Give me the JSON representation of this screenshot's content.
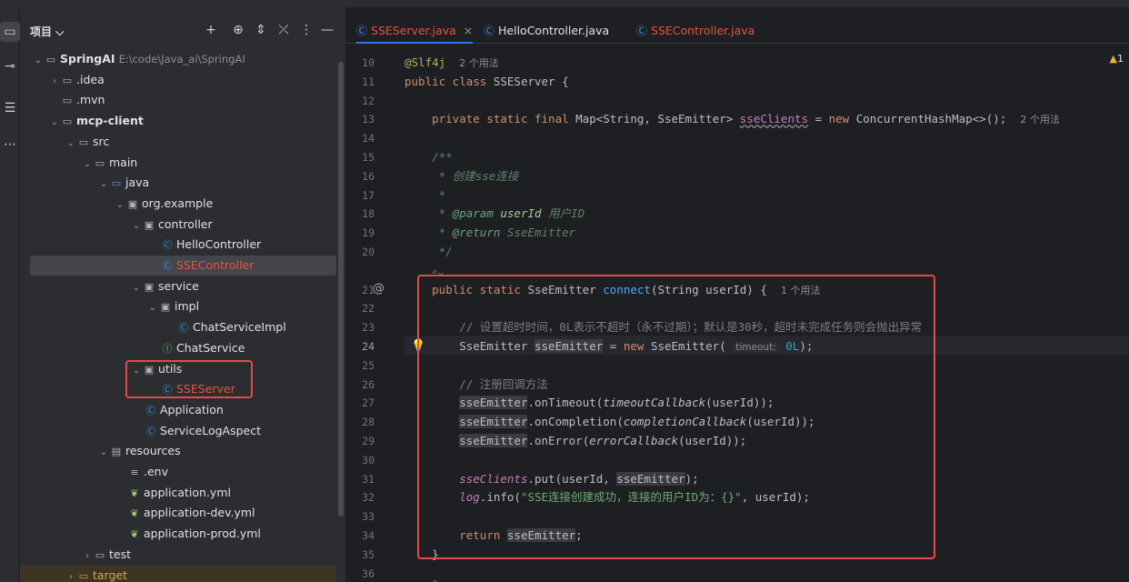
{
  "project": {
    "title": "项目",
    "tree": [
      {
        "name": "SpringAI",
        "extra": "E:\\code\\Java_ai\\SpringAI",
        "icon": "module-folder-icon"
      },
      {
        "name": ".idea",
        "icon": "folder-icon"
      },
      {
        "name": ".mvn",
        "icon": "folder-icon"
      },
      {
        "name": "mcp-client",
        "icon": "module-folder-icon"
      },
      {
        "name": "src",
        "icon": "folder-icon"
      },
      {
        "name": "main",
        "icon": "folder-icon"
      },
      {
        "name": "java",
        "icon": "source-folder-icon"
      },
      {
        "name": "org.example",
        "icon": "package-icon"
      },
      {
        "name": "controller",
        "icon": "package-icon"
      },
      {
        "name": "HelloController",
        "icon": "class-icon"
      },
      {
        "name": "SSEController",
        "icon": "class-icon"
      },
      {
        "name": "service",
        "icon": "package-icon"
      },
      {
        "name": "impl",
        "icon": "package-icon"
      },
      {
        "name": "ChatServiceImpl",
        "icon": "class-icon"
      },
      {
        "name": "ChatService",
        "icon": "interface-icon"
      },
      {
        "name": "utils",
        "icon": "package-icon"
      },
      {
        "name": "SSEServer",
        "icon": "class-icon"
      },
      {
        "name": "Application",
        "icon": "spring-class-icon"
      },
      {
        "name": "ServiceLogAspect",
        "icon": "class-icon"
      },
      {
        "name": "resources",
        "icon": "resources-folder-icon"
      },
      {
        "name": ".env",
        "icon": "env-file-icon"
      },
      {
        "name": "application.yml",
        "icon": "yaml-icon"
      },
      {
        "name": "application-dev.yml",
        "icon": "yaml-icon"
      },
      {
        "name": "application-prod.yml",
        "icon": "yaml-icon"
      },
      {
        "name": "test",
        "icon": "folder-icon"
      },
      {
        "name": "target",
        "icon": "folder-icon"
      }
    ]
  },
  "tabs": [
    {
      "label": "SSEServer.java",
      "active": true
    },
    {
      "label": "HelloController.java",
      "active": false
    },
    {
      "label": "SSEController.java",
      "active": false
    }
  ],
  "editor": {
    "warnings": "1",
    "line_numbers": [
      "10",
      "11",
      "12",
      "13",
      "14",
      "15",
      "16",
      "17",
      "18",
      "19",
      "20",
      "",
      "21",
      "22",
      "23",
      "24",
      "25",
      "26",
      "27",
      "28",
      "29",
      "30",
      "31",
      "32",
      "33",
      "34",
      "35",
      "36"
    ],
    "usage_hint_2": "2 个用法",
    "usage_hint_1": "1 个用法",
    "javadoc_create": "创建sse连接",
    "param_desc": "用户ID",
    "comment_timeout": "// 设置超时时间，0L表示不超时（永不过期）；默认是30秒，超时未完成任务则会抛出异常",
    "comment_callbacks": "// 注册回调方法",
    "inlay_timeout": "timeout:",
    "log_message": "\"SSE连接创建成功，连接的用户ID为：{}\""
  }
}
